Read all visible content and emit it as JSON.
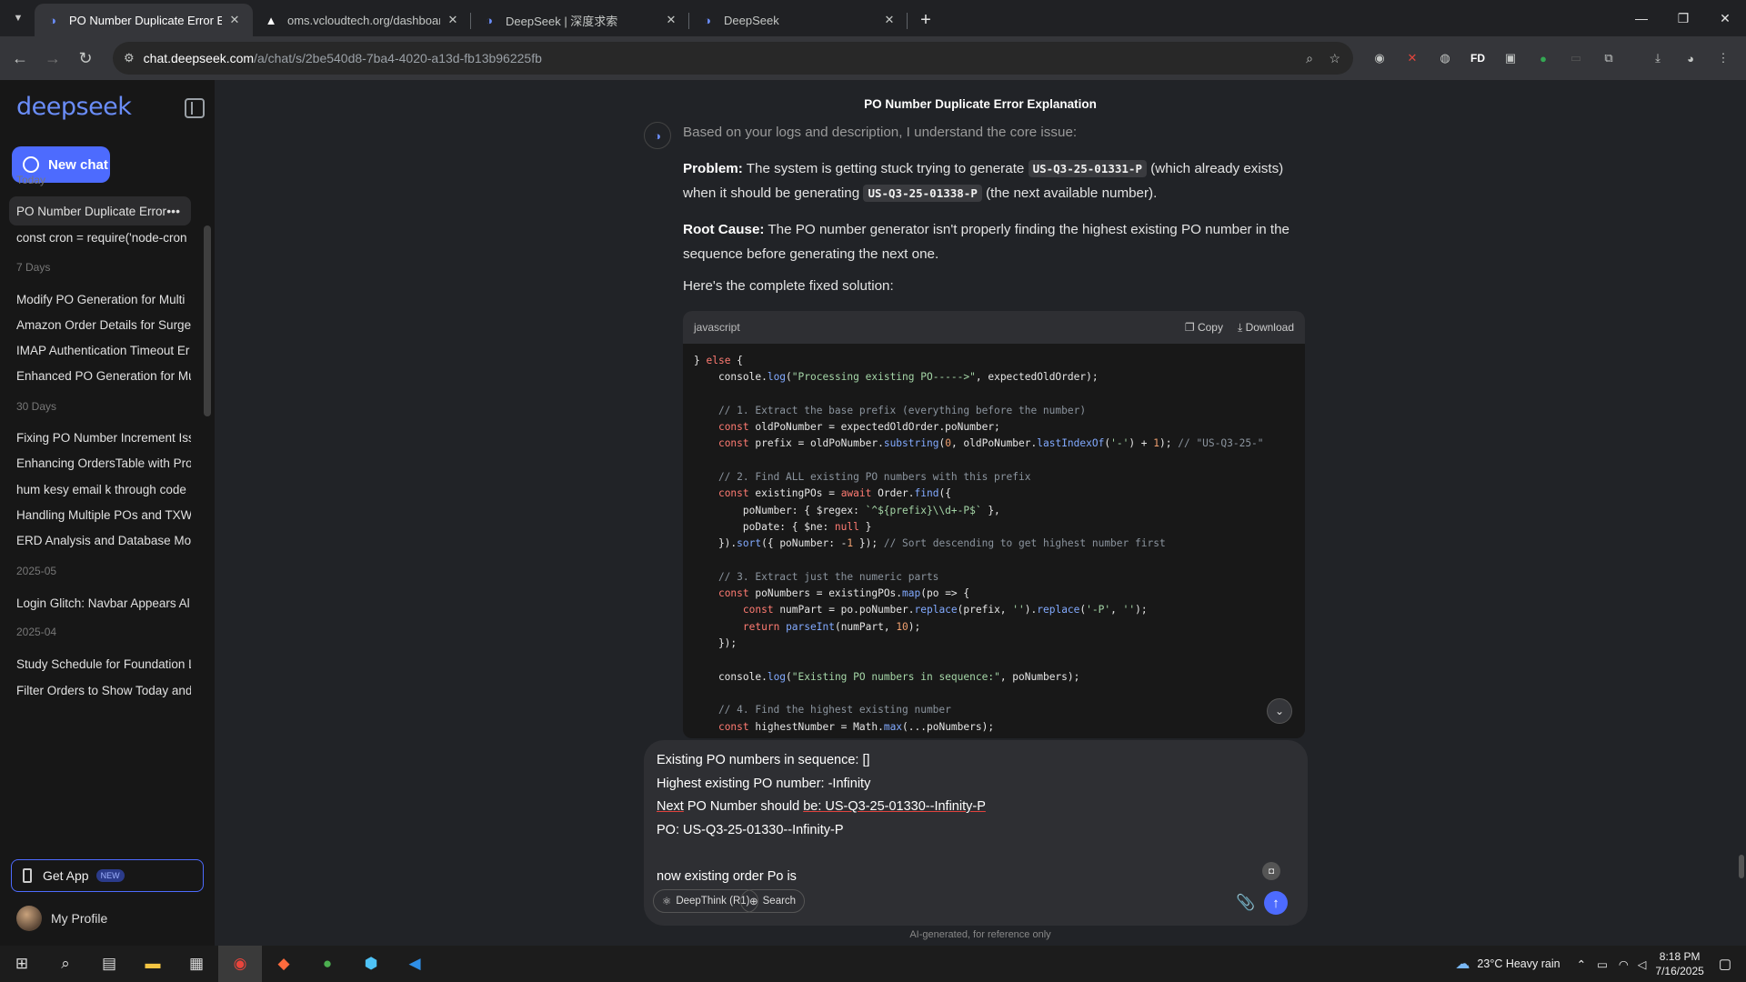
{
  "browser": {
    "tabs": [
      {
        "title": "PO Number Duplicate Error Exp",
        "icon": "deepseek-icon",
        "active": true
      },
      {
        "title": "oms.vcloudtech.org/dashboard",
        "icon": "triangle-icon",
        "active": false
      },
      {
        "title": "DeepSeek | 深度求索",
        "icon": "deepseek-icon",
        "active": false
      },
      {
        "title": "DeepSeek",
        "icon": "deepseek-icon",
        "active": false
      }
    ],
    "new_tab": "+",
    "url_host": "chat.deepseek.com",
    "url_path": "/a/chat/s/2be540d8-7ba4-4020-a13d-fb13b96225fb",
    "ext_fd": "FD"
  },
  "sidebar": {
    "logo": "deepseek",
    "new_chat": "New chat",
    "groups": [
      {
        "label": "Today",
        "items": [
          "PO Number Duplicate Error",
          "const cron = require('node-cron"
        ]
      },
      {
        "label": "7 Days",
        "items": [
          "Modify PO Generation for Multi",
          "Amazon Order Details for Surge",
          "IMAP Authentication Timeout Er",
          "Enhanced PO Generation for Mu"
        ]
      },
      {
        "label": "30 Days",
        "items": [
          "Fixing PO Number Increment Iss",
          "Enhancing OrdersTable with Pro",
          "hum kesy email k through code",
          "Handling Multiple POs and TXW",
          "ERD Analysis and Database Mod"
        ]
      },
      {
        "label": "2025-05",
        "items": [
          "Login Glitch: Navbar Appears Al"
        ]
      },
      {
        "label": "2025-04",
        "items": [
          "Study Schedule for Foundation L",
          "Filter Orders to Show Today and"
        ]
      }
    ],
    "get_app": "Get App",
    "get_app_badge": "NEW",
    "profile": "My Profile"
  },
  "chat": {
    "title": "PO Number Duplicate Error Explanation",
    "intro": "Based on your logs and description, I understand the core issue:",
    "problem_label": "Problem:",
    "problem_text_1": " The system is getting stuck trying to generate ",
    "problem_code_1": "US-Q3-25-01331-P",
    "problem_text_2": " (which already exists) when it should be generating ",
    "problem_code_2": "US-Q3-25-01338-P",
    "problem_text_3": " (the next available number).",
    "root_label": "Root Cause:",
    "root_text": " The PO number generator isn't properly finding the highest existing PO number in the sequence before generating the next one.",
    "solution_intro": "Here's the complete fixed solution:",
    "code_lang": "javascript",
    "copy": "Copy",
    "download": "Download",
    "code_lines": [
      "} else {",
      "    console.log(\"Processing existing PO----->\", expectedOldOrder);",
      "",
      "    // 1. Extract the base prefix (everything before the number)",
      "    const oldPoNumber = expectedOldOrder.poNumber;",
      "    const prefix = oldPoNumber.substring(0, oldPoNumber.lastIndexOf('-') + 1); // \"US-Q3-25-\"",
      "",
      "    // 2. Find ALL existing PO numbers with this prefix",
      "    const existingPOs = await Order.find({",
      "        poNumber: { $regex: `^${prefix}\\\\d+-P$` },",
      "        poDate: { $ne: null }",
      "    }).sort({ poNumber: -1 }); // Sort descending to get highest number first",
      "",
      "    // 3. Extract just the numeric parts",
      "    const poNumbers = existingPOs.map(po => {",
      "        const numPart = po.poNumber.replace(prefix, '').replace('-P', '');",
      "        return parseInt(numPart, 10);",
      "    });",
      "",
      "    console.log(\"Existing PO numbers in sequence:\", poNumbers);",
      "",
      "    // 4. Find the highest existing number",
      "    const highestNumber = Math.max(...poNumbers);"
    ]
  },
  "composer": {
    "line1": "Existing PO numbers in sequence: []",
    "line2": "Highest existing PO number: -Infinity",
    "line3_a": "Next",
    "line3_b": " PO Number should ",
    "line3_c": "be: US-Q3-25-01330--Infinity-P",
    "line4": "PO: US-Q3-25-01330--Infinity-P",
    "line5": "now existing order Po is",
    "deepthink": "DeepThink (R1)",
    "search": "Search"
  },
  "disclaimer": "AI-generated, for reference only",
  "taskbar": {
    "weather": "23°C  Heavy rain",
    "time": "8:18 PM",
    "date": "7/16/2025"
  }
}
